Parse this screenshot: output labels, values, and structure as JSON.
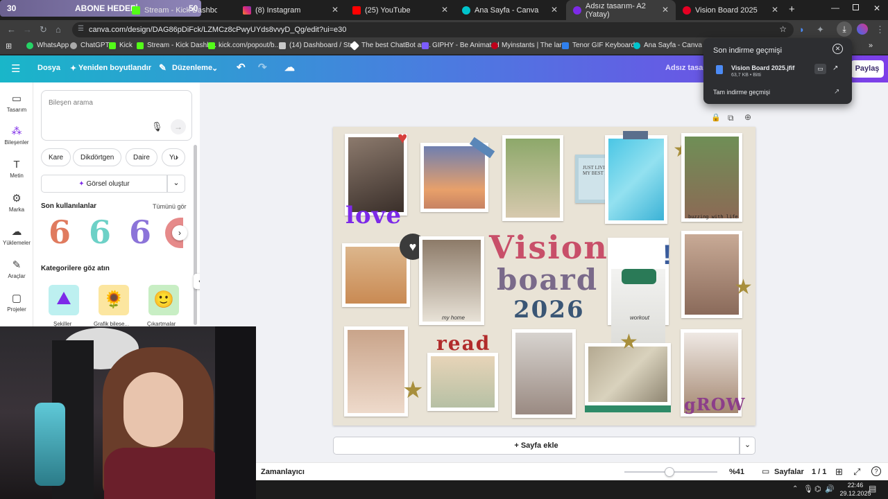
{
  "abone": {
    "left_count": "30",
    "title": "ABONE HEDEFİ",
    "right_count": "50"
  },
  "tabs": [
    {
      "label": "Stream - Kick Dashboard",
      "color": "#53fc18"
    },
    {
      "label": "(8) Instagram",
      "color": "#e1306c"
    },
    {
      "label": "(25) YouTube",
      "color": "#ff0000"
    },
    {
      "label": "Ana Sayfa - Canva",
      "color": "#00c4cc"
    },
    {
      "label": "Adsız tasarım- A2 (Yatay)",
      "color": "#7d2ae8"
    },
    {
      "label": "Vision Board 2025",
      "color": "#e60023"
    }
  ],
  "url": "canva.com/design/DAG86pDiFck/LZMCz8cPwyUYds8vvyD_Qg/edit?ui=e30",
  "bookmarks": [
    "WhatsApp",
    "ChatGPT",
    "Kick",
    "Stream - Kick Dashb...",
    "kick.com/popout/b...",
    "(14) Dashboard / Str...",
    "The best ChatBot an...",
    "GIPHY - Be Animated",
    "Myinstants | The lar...",
    "Tenor GIF Keyboard...",
    "Ana Sayfa - Canva"
  ],
  "toolbar": {
    "file": "Dosya",
    "resize": "Yeniden boyutlandır",
    "edit": "Düzenleme",
    "title_partial": "Adsız tasarı",
    "share": "Paylaş"
  },
  "rail": [
    "Tasarım",
    "Bileşenler",
    "Metin",
    "Marka",
    "Yüklemeler",
    "Araçlar",
    "Projeler"
  ],
  "panel": {
    "search_placeholder": "Bileşen arama",
    "chips": [
      "Kare",
      "Dikdörtgen",
      "Daire",
      "Yu"
    ],
    "generate": "Görsel oluştur",
    "recent_title": "Son kullanılanlar",
    "see_all": "Tümünü gör",
    "categories_title": "Kategorilere göz atın",
    "categories": [
      "Şekiller",
      "Grafik bilese...",
      "Çıkartmalar"
    ]
  },
  "board": {
    "love": "love",
    "vision": "Vision",
    "board_word": "board",
    "year": "2026",
    "read": "read",
    "grow": "gROW",
    "quote": "JUST LIVING MY BEST LIFE",
    "buzzing": "buzzing with life",
    "my_home": "my home",
    "workout": "workout"
  },
  "add_page": "+ Sayfa ekle",
  "bottom": {
    "timer": "Zamanlayıcı",
    "zoom": "%41",
    "pages": "Sayfalar",
    "page_count": "1 / 1",
    "zoom_level": 0.41
  },
  "download": {
    "title": "Son indirme geçmişi",
    "file": "Vision Board 2025.jfif",
    "meta": "63,7 KB • Bitti",
    "history": "Tam indirme geçmişi"
  },
  "clock": {
    "time": "22:46",
    "date": "29.12.2025"
  }
}
